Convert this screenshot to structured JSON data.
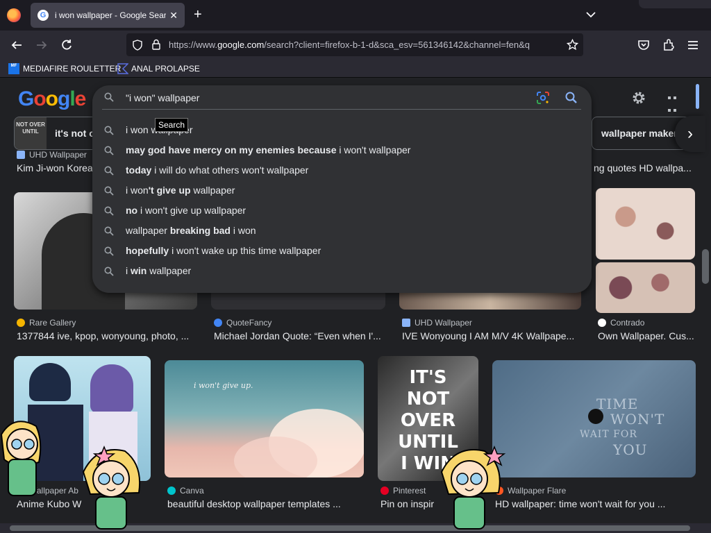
{
  "browser": {
    "tab": {
      "title": "i won wallpaper - Google Search",
      "favicon": "G"
    },
    "url": {
      "prefix": "https://www.",
      "host": "google.com",
      "rest": "/search?client=firefox-b-1-d&sca_esv=561346142&channel=fen&q"
    },
    "bookmarks": [
      {
        "label": "MEDIAFIRE ROULETTER",
        "icon": "MF"
      },
      {
        "label": "ANAL PROLAPSE"
      }
    ]
  },
  "google": {
    "logo": [
      "G",
      "o",
      "o",
      "g",
      "l",
      "e"
    ],
    "search": {
      "value": "\"i won\" wallpaper"
    },
    "tooltip": "Search",
    "suggestions": [
      {
        "pre": "i won ",
        "bold": "",
        "post": "wallpaper"
      },
      {
        "pre": "",
        "bold": "may god have mercy on my enemies because",
        "post": " i won't wallpaper"
      },
      {
        "pre": "",
        "bold": "today",
        "post": " i will do what others won't wallpaper"
      },
      {
        "pre": "i won",
        "bold": "'t give up",
        "post": " wallpaper"
      },
      {
        "pre": "",
        "bold": "no",
        "post": " i won't give up wallpaper"
      },
      {
        "pre": "wallpaper ",
        "bold": "breaking bad",
        "post": " i won"
      },
      {
        "pre": "",
        "bold": "hopefully",
        "post": " i won't wake up this time wallpaper"
      },
      {
        "pre": "i ",
        "bold": "win",
        "post": " wallpaper"
      }
    ],
    "chips": [
      {
        "label": "it's not o",
        "thumb": "NOT OVER UNTIL"
      },
      {
        "label": "wallpaper maker"
      }
    ],
    "row0": [
      {
        "source": "UHD Wallpaper",
        "caption": "Kim Ji-won Korea"
      },
      {
        "source": "",
        "caption": "ng quotes HD wallpa..."
      }
    ],
    "row1": [
      {
        "source": "Rare Gallery",
        "caption": "1377844 ive, kpop, wonyoung, photo, ...",
        "fav": "#f4b400"
      },
      {
        "source": "QuoteFancy",
        "caption": "Michael Jordan Quote: “Even when I'...",
        "fav": "#4285f4"
      },
      {
        "source": "UHD Wallpaper",
        "caption": "IVE Wonyoung I AM M/V 4K Wallpape...",
        "fav": "#8ab4f8"
      },
      {
        "source": "Contrado",
        "caption": "Own Wallpaper. Cus...",
        "fav": "#ffffff"
      }
    ],
    "row2": [
      {
        "source": "Wallpaper Ab",
        "caption": "Anime Kubo W",
        "fav": "#9aa0a6"
      },
      {
        "source": "Canva",
        "caption": "beautiful desktop wallpaper templates ...",
        "fav": "#00c4cc"
      },
      {
        "source": "Pinterest",
        "caption": "Pin on inspir",
        "fav": "#e60023"
      },
      {
        "source": "Wallpaper Flare",
        "caption": "HD wallpaper: time won't wait for you ...",
        "fav": "#ff5722"
      }
    ],
    "image_text": {
      "quote_cloud": "i won't give up.",
      "not_over": [
        "IT'S",
        "NOT",
        "OVER",
        "UNTIL",
        "I WIN"
      ],
      "time_wait": [
        "TIME",
        "WON'T",
        "WAIT FOR",
        "YOU"
      ]
    }
  }
}
